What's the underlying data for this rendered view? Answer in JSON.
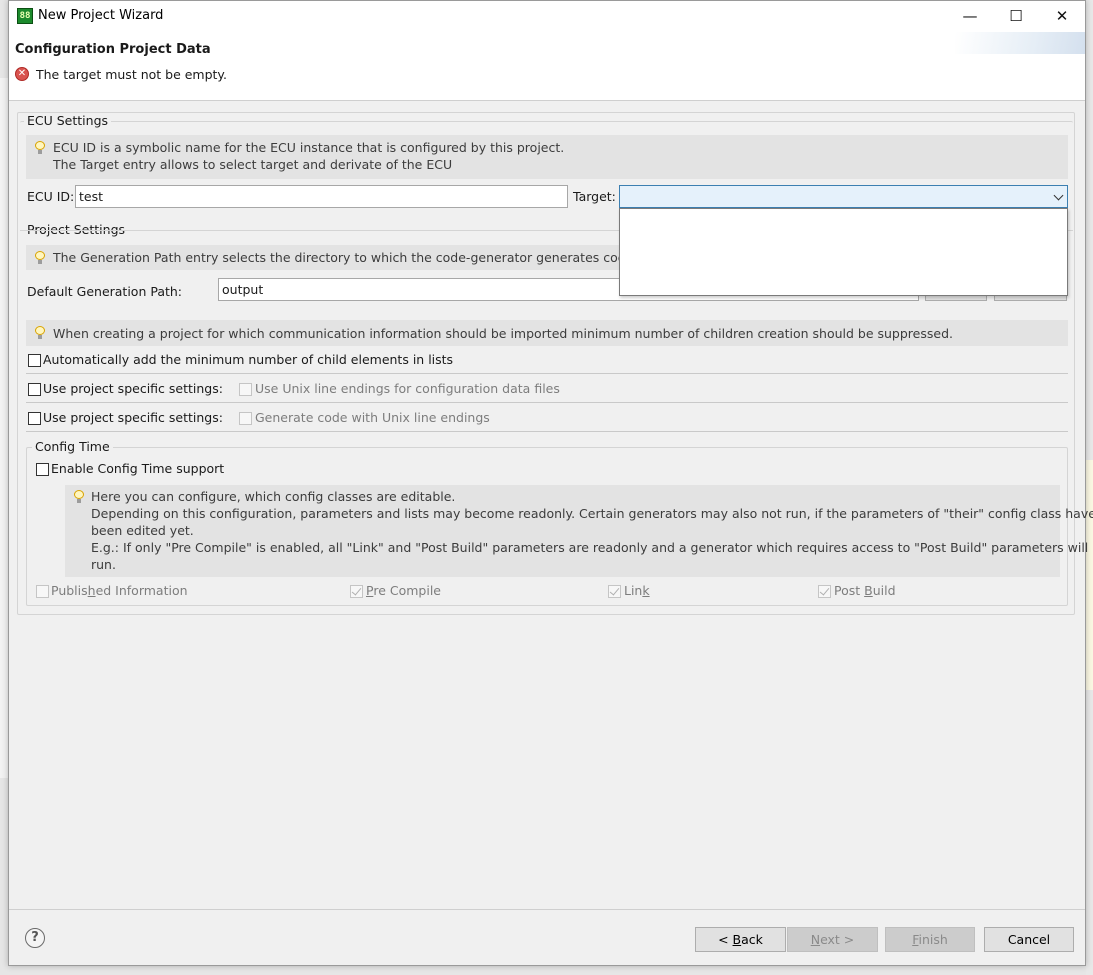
{
  "window": {
    "title": "New Project Wizard",
    "app_icon_text": "88",
    "minimize": "—",
    "maximize": "☐",
    "close": "✕"
  },
  "header": {
    "title": "Configuration Project Data",
    "error_message": "The target must not be empty."
  },
  "ecu_settings": {
    "group_label": "ECU Settings",
    "info_line1": "ECU ID is a symbolic name for the ECU instance that is configured by this project.",
    "info_line2": "The Target entry allows to select target and derivate of the ECU",
    "ecu_id_label": "ECU ID:",
    "ecu_id_value": "test",
    "target_label": "Target:",
    "target_value": ""
  },
  "project_settings": {
    "group_label": "Project Settings",
    "info": "The Generation Path entry selects the directory to which the code-generator generates code",
    "gen_path_label": "Default Generation Path:",
    "gen_path_value": "output",
    "min_children_info": "When creating a project for which communication information should be imported minimum number of children creation should be suppressed.",
    "auto_add_label": "Automatically add the minimum number of child elements in lists",
    "project_specific_1": "Use project specific settings:",
    "unix_line_endings_config": "Use Unix line endings for configuration data files",
    "project_specific_2": "Use project specific settings:",
    "unix_line_endings_code": "Generate code with Unix line endings"
  },
  "config_time": {
    "group_label": "Config Time",
    "enable_label": "Enable Config Time support",
    "info_line1": "Here you can configure, which config classes are editable.",
    "info_line2": "Depending on this configuration, parameters and lists may become readonly. Certain generators may also not run, if the parameters of \"their\" config class have not",
    "info_line3": "been edited yet.",
    "info_line4": "E.g.: If only \"Pre Compile\" is enabled, all \"Link\" and \"Post Build\" parameters are readonly and a generator which requires access to \"Post Build\" parameters will not",
    "info_line5": "run.",
    "published_pre": "Publis",
    "published_u": "h",
    "published_post": "ed Information",
    "precompile_u": "P",
    "precompile_post": "re Compile",
    "link_pre": "Lin",
    "link_u": "k",
    "postbuild_pre": "Post ",
    "postbuild_u": "B",
    "postbuild_post": "uild"
  },
  "footer": {
    "help": "?",
    "back_pre": "< ",
    "back_u": "B",
    "back_post": "ack",
    "next_u": "N",
    "next_post": "ext >",
    "finish_u": "F",
    "finish_post": "inish",
    "cancel": "Cancel"
  }
}
